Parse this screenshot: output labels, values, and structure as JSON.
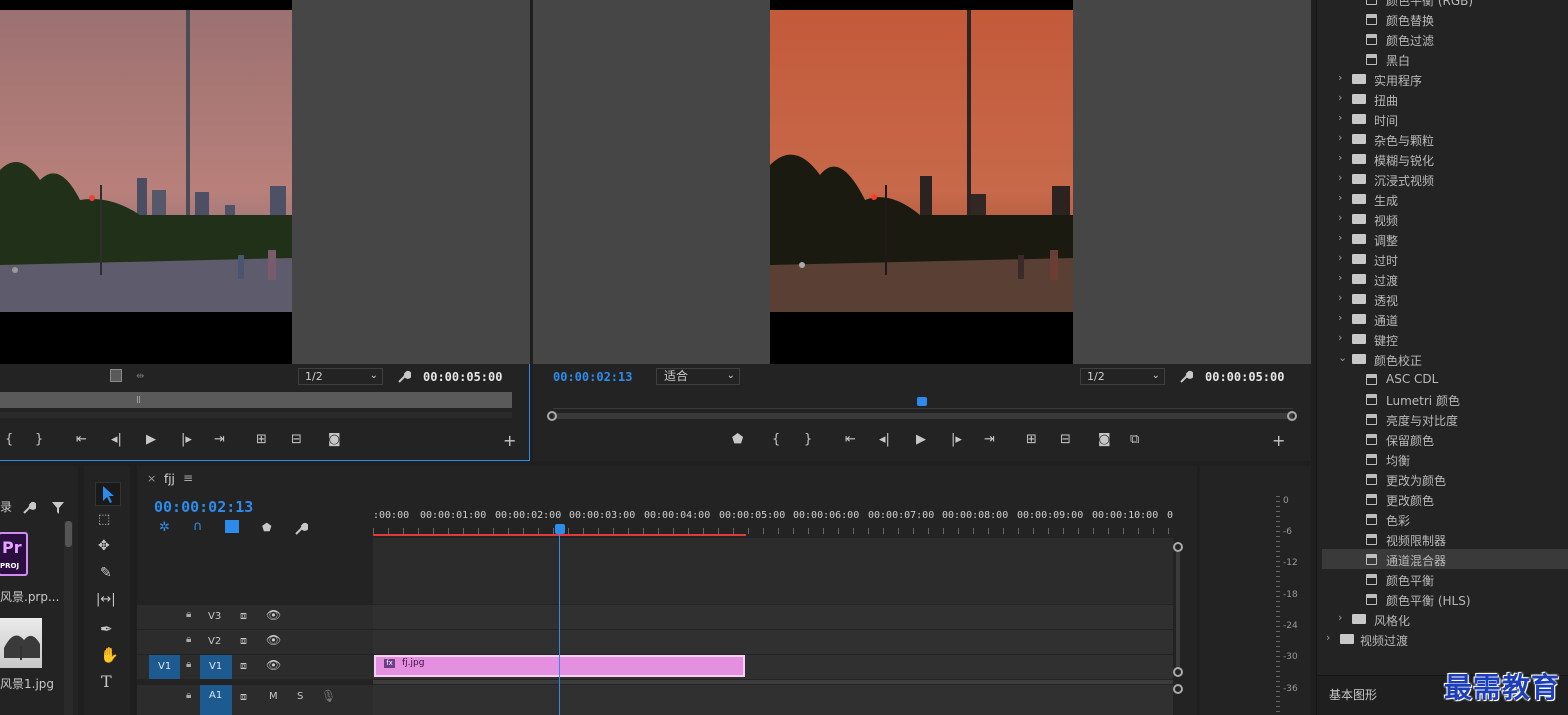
{
  "source_monitor": {
    "resolution": "1/2",
    "duration": "00:00:05:00"
  },
  "program_monitor": {
    "timecode": "00:00:02:13",
    "fit": "适合",
    "resolution": "1/2",
    "duration": "00:00:05:00"
  },
  "project": {
    "header_partial": "录",
    "items": [
      {
        "badge_top": "Pr",
        "badge_bottom": "PROJ",
        "name": "风景.prp..."
      },
      {
        "name": "风景1.jpg"
      }
    ]
  },
  "timeline": {
    "sequence_name": "fjj",
    "timecode": "00:00:02:13",
    "ruler": [
      ":00:00",
      "00:00:01:00",
      "00:00:02:00",
      "00:00:03:00",
      "00:00:04:00",
      "00:00:05:00",
      "00:00:06:00",
      "00:00:07:00",
      "00:00:08:00",
      "00:00:09:00",
      "00:00:10:00",
      "0"
    ],
    "tracks": {
      "v3": "V3",
      "v2": "V2",
      "v1_source": "V1",
      "v1": "V1",
      "a1": "A1",
      "mute": "M",
      "solo": "S"
    },
    "clip": {
      "badge": "fx",
      "name": "fj.jpg"
    }
  },
  "vu_meter": {
    "labels": [
      "0",
      "-6",
      "-12",
      "-18",
      "-24",
      "-30",
      "-36"
    ]
  },
  "effects": {
    "items": [
      {
        "type": "effect",
        "label": "颜色平衡 (RGB)"
      },
      {
        "type": "effect",
        "label": "颜色替换"
      },
      {
        "type": "effect",
        "label": "颜色过滤"
      },
      {
        "type": "effect",
        "label": "黑白"
      },
      {
        "type": "folder",
        "label": "实用程序"
      },
      {
        "type": "folder",
        "label": "扭曲"
      },
      {
        "type": "folder",
        "label": "时间"
      },
      {
        "type": "folder",
        "label": "杂色与颗粒"
      },
      {
        "type": "folder",
        "label": "模糊与锐化"
      },
      {
        "type": "folder",
        "label": "沉浸式视频"
      },
      {
        "type": "folder",
        "label": "生成"
      },
      {
        "type": "folder",
        "label": "视频"
      },
      {
        "type": "folder",
        "label": "调整"
      },
      {
        "type": "folder",
        "label": "过时"
      },
      {
        "type": "folder",
        "label": "过渡"
      },
      {
        "type": "folder",
        "label": "透视"
      },
      {
        "type": "folder",
        "label": "通道"
      },
      {
        "type": "folder",
        "label": "键控"
      },
      {
        "type": "folder-open",
        "label": "颜色校正"
      },
      {
        "type": "effect",
        "label": "ASC CDL"
      },
      {
        "type": "effect",
        "label": "Lumetri 颜色"
      },
      {
        "type": "effect",
        "label": "亮度与对比度"
      },
      {
        "type": "effect",
        "label": "保留颜色"
      },
      {
        "type": "effect",
        "label": "均衡"
      },
      {
        "type": "effect",
        "label": "更改为颜色"
      },
      {
        "type": "effect",
        "label": "更改颜色"
      },
      {
        "type": "effect",
        "label": "色彩"
      },
      {
        "type": "effect",
        "label": "视频限制器"
      },
      {
        "type": "effect",
        "label": "通道混合器",
        "selected": true
      },
      {
        "type": "effect",
        "label": "颜色平衡"
      },
      {
        "type": "effect",
        "label": "颜色平衡 (HLS)"
      },
      {
        "type": "folder",
        "label": "风格化"
      },
      {
        "type": "folder-root",
        "label": "视频过渡"
      }
    ],
    "bottom_tab": "基本图形"
  },
  "watermark": "最需教育"
}
